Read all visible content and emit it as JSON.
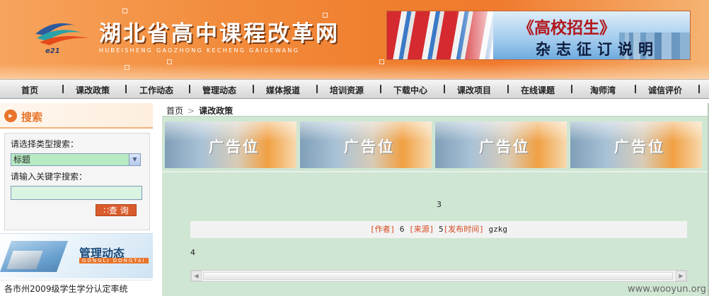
{
  "header": {
    "site_title": "湖北省高中课程改革网",
    "site_pinyin": "HUBEISHENG GAOZHONG KECHENG GAIGEWANG",
    "logo_text": "e21",
    "banner_line1": "《高校招生》",
    "banner_line2": "杂志征订说明"
  },
  "nav": {
    "items": [
      "首页",
      "课改政策",
      "工作动态",
      "管理动态",
      "媒体报道",
      "培训资源",
      "下载中心",
      "课改项目",
      "在线课题",
      "淘师湾",
      "诚信评价"
    ]
  },
  "sidebar": {
    "search_title": "搜索",
    "type_label": "请选择类型搜索：",
    "type_selected": "标题",
    "keyword_label": "请输入关键字搜索：",
    "keyword_value": "",
    "search_button": "∷查 询",
    "mgmt_title": "管理动态",
    "mgmt_subtitle": "GONGLI DONGTAI",
    "news_item": "各市州2009级学生学分认定率统"
  },
  "breadcrumb": {
    "home": "首页",
    "current": "课改政策"
  },
  "ads": [
    "广告位",
    "广告位",
    "广告位",
    "广告位"
  ],
  "article": {
    "title": "3",
    "author_label": "[作者]",
    "author_value": "6",
    "source_label": "[来源]",
    "source_value": "5",
    "time_label": "[发布时间]",
    "time_value": "gzkg",
    "body": "4"
  },
  "watermark": "www.wooyun.org",
  "colors": {
    "accent_orange": "#e8742a",
    "main_bg": "#cfe6d3",
    "meta_red": "#d44a1f"
  }
}
